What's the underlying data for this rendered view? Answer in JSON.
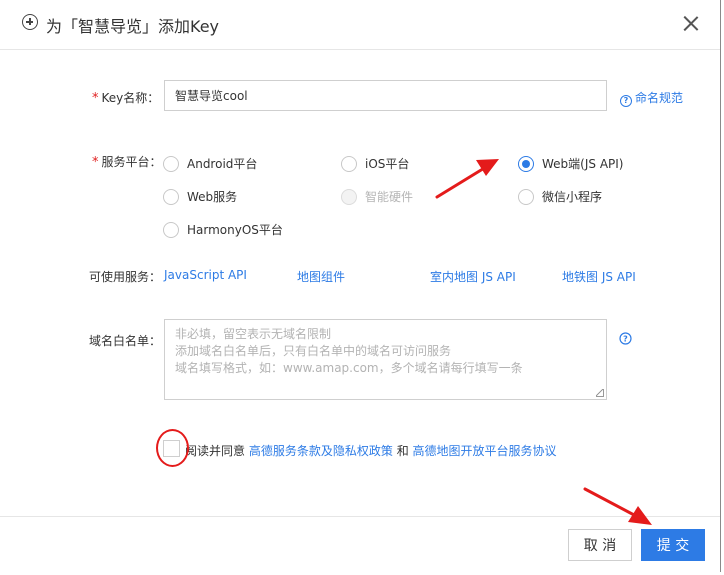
{
  "dialog": {
    "title": "为「智慧导览」添加Key",
    "close_icon": "close-icon",
    "title_icon": "plus-circle-icon"
  },
  "form": {
    "key_name": {
      "required_mark": "*",
      "label": "Key名称：",
      "value": "智慧导览cool",
      "help_link": "命名规范"
    },
    "platform": {
      "required_mark": "*",
      "label": "服务平台：",
      "options": [
        {
          "label": "Android平台",
          "checked": false,
          "disabled": false
        },
        {
          "label": "iOS平台",
          "checked": false,
          "disabled": false
        },
        {
          "label": "Web端(JS API)",
          "checked": true,
          "disabled": false
        },
        {
          "label": "Web服务",
          "checked": false,
          "disabled": false
        },
        {
          "label": "智能硬件",
          "checked": false,
          "disabled": true
        },
        {
          "label": "微信小程序",
          "checked": false,
          "disabled": false
        },
        {
          "label": "HarmonyOS平台",
          "checked": false,
          "disabled": false
        }
      ]
    },
    "services": {
      "label": "可使用服务：",
      "links": [
        "JavaScript API",
        "地图组件",
        "室内地图 JS API",
        "地铁图 JS API"
      ]
    },
    "whitelist": {
      "label": "域名白名单：",
      "placeholder_lines": [
        "非必填，留空表示无域名限制",
        "添加域名白名单后，只有白名单中的域名可访问服务",
        "域名填写格式，如：www.amap.com，多个域名请每行填写一条"
      ]
    },
    "agreement": {
      "checked": false,
      "prefix": "阅读并同意",
      "link1": "高德服务条款及隐私权政策",
      "and": "和",
      "link2": "高德地图开放平台服务协议"
    }
  },
  "footer": {
    "cancel_label": "取 消",
    "submit_label": "提 交"
  },
  "colors": {
    "accent": "#2d7be5",
    "required": "#e02020",
    "annotation": "#e41b1b"
  }
}
